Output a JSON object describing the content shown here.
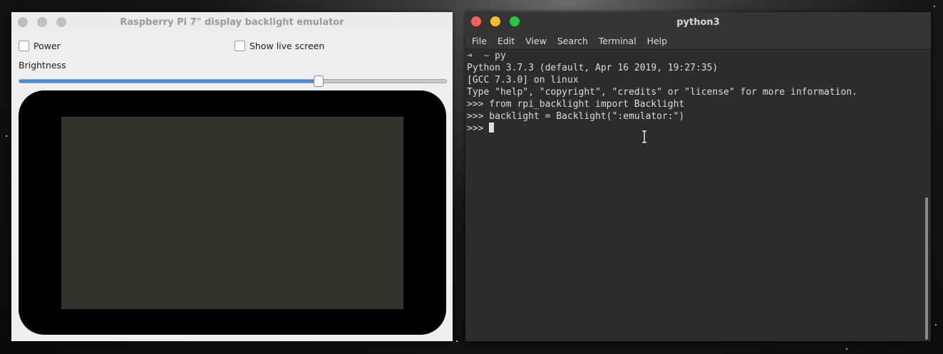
{
  "emulator": {
    "title": "Raspberry Pi 7\" display backlight emulator",
    "power_label": "Power",
    "power_checked": false,
    "live_screen_label": "Show live screen",
    "live_screen_checked": false,
    "brightness_label": "Brightness",
    "brightness_level": 0.7,
    "screen_color": "#35342c"
  },
  "terminal": {
    "title": "python3",
    "menu": [
      "File",
      "Edit",
      "View",
      "Search",
      "Terminal",
      "Help"
    ],
    "prompt_arrow": "➜",
    "prompt_tilde": "~",
    "first_command": "py",
    "lines": [
      "Python 3.7.3 (default, Apr 16 2019, 19:27:35)",
      "[GCC 7.3.0] on linux",
      "Type \"help\", \"copyright\", \"credits\" or \"license\" for more information.",
      ">>> from rpi_backlight import Backlight",
      ">>> backlight = Backlight(\":emulator:\")"
    ],
    "current_prompt": ">>> "
  },
  "colors": {
    "close": "#ff5f57",
    "minimize": "#febc2e",
    "maximize": "#28c840",
    "slider_fill": "#3a8ee6"
  }
}
